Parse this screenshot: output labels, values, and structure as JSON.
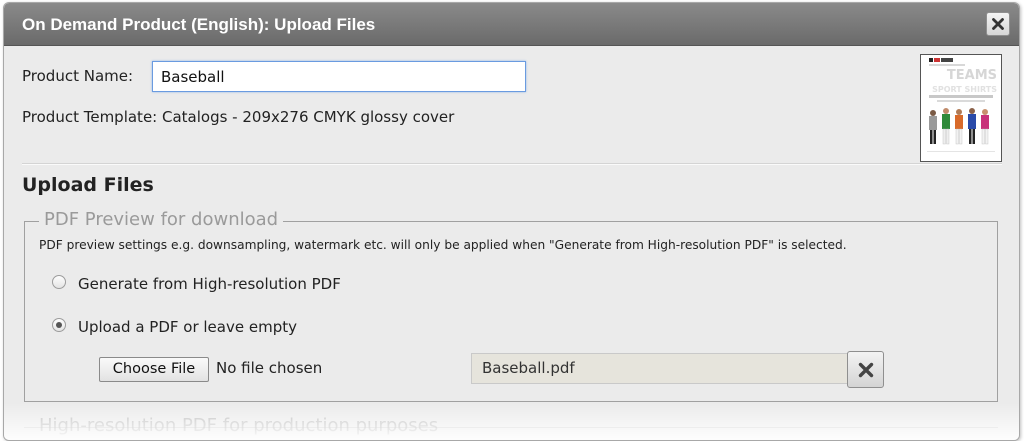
{
  "dialog": {
    "title": "On Demand Product (English): Upload Files",
    "close_icon": "close-icon"
  },
  "product": {
    "name_label": "Product Name:",
    "name_value": "Baseball",
    "template_text": "Product Template: Catalogs - 209x276 CMYK glossy cover",
    "thumbnail": {
      "heading": "TEAMS",
      "subheading": "SPORT SHIRTS"
    }
  },
  "upload": {
    "heading": "Upload Files",
    "preview": {
      "legend": "PDF Preview for download",
      "hint": "PDF preview settings e.g. downsampling, watermark etc. will only be applied when \"Generate from High-resolution PDF\" is selected.",
      "options": [
        {
          "label": "Generate from High-resolution PDF",
          "selected": false
        },
        {
          "label": "Upload a PDF or leave empty",
          "selected": true
        }
      ],
      "file_button": "Choose File",
      "file_status": "No file chosen",
      "file_name": "Baseball.pdf",
      "clear_icon": "close-icon"
    },
    "next_section_legend": "High-resolution PDF for production purposes"
  },
  "colors": {
    "titlebar": "#7a7a7a",
    "dialog_bg": "#ebebeb",
    "input_focus_border": "#6a9be0",
    "legend_text": "#9a9a9a"
  }
}
